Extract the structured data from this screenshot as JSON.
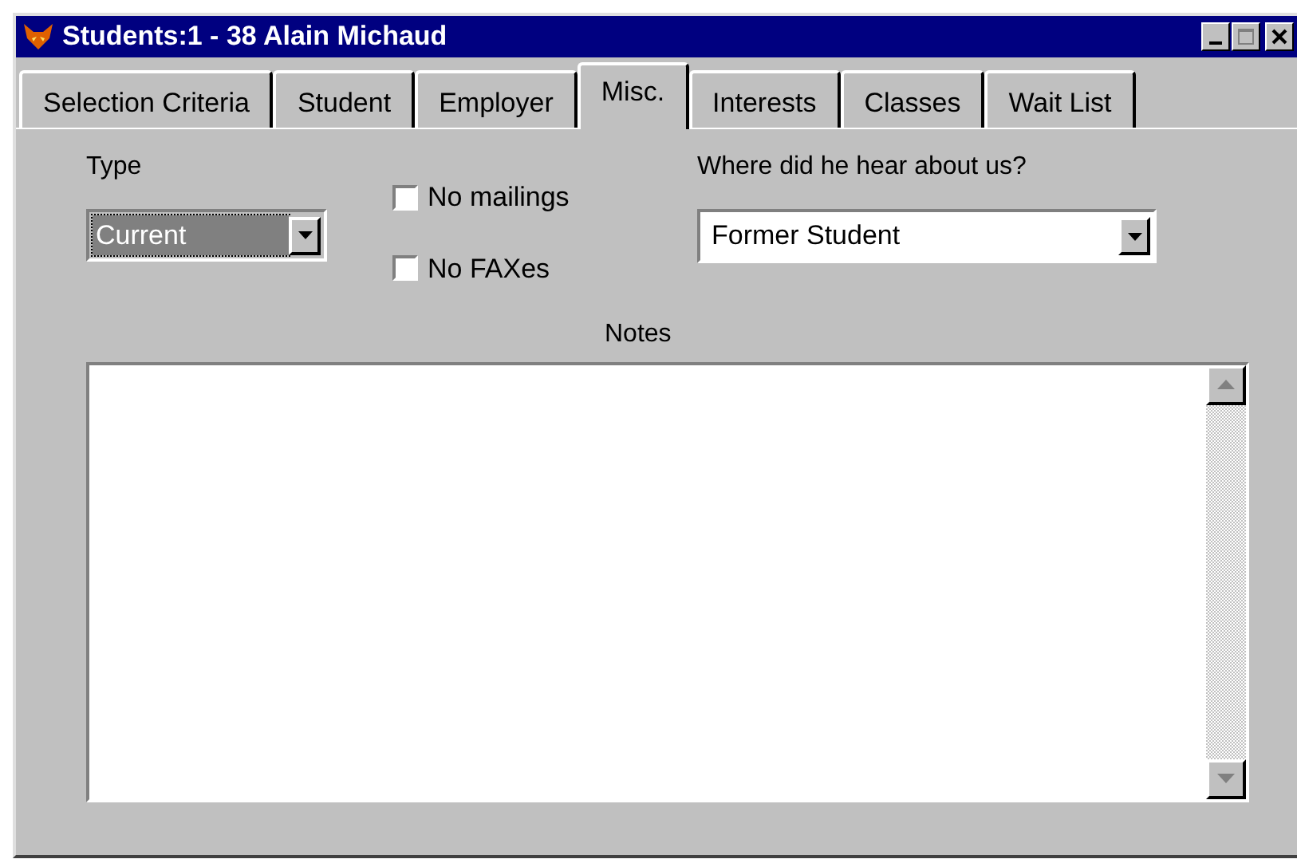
{
  "window": {
    "title": "Students:1 - 38 Alain Michaud"
  },
  "tabs": [
    {
      "label": "Selection Criteria",
      "selected": false
    },
    {
      "label": "Student",
      "selected": false
    },
    {
      "label": "Employer",
      "selected": false
    },
    {
      "label": "Misc.",
      "selected": true
    },
    {
      "label": "Interests",
      "selected": false
    },
    {
      "label": "Classes",
      "selected": false
    },
    {
      "label": "Wait List",
      "selected": false
    }
  ],
  "type": {
    "label": "Type",
    "value": "Current",
    "focused": true
  },
  "checkboxes": [
    {
      "label": "No mailings",
      "checked": false
    },
    {
      "label": "No FAXes",
      "checked": false
    }
  ],
  "source": {
    "label": "Where did he hear about us?",
    "value": "Former Student"
  },
  "notes": {
    "label": "Notes"
  }
}
